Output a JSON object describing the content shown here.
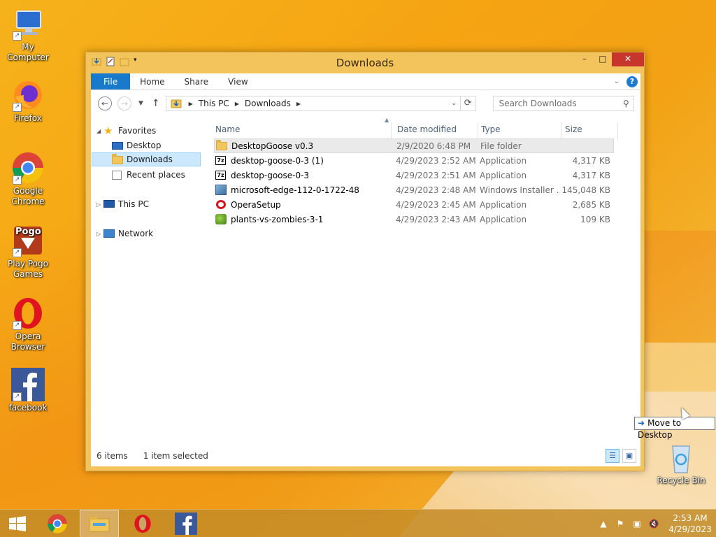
{
  "desktop": {
    "icons": [
      {
        "label": "My Computer"
      },
      {
        "label": "Firefox"
      },
      {
        "label": "Google Chrome"
      },
      {
        "label": "Play Pogo Games"
      },
      {
        "label": "Opera Browser"
      },
      {
        "label": "facebook"
      },
      {
        "label": "Recycle Bin"
      }
    ],
    "pogo_text": "Pogo"
  },
  "window": {
    "title": "Downloads",
    "controls": {
      "minimize": "–",
      "maximize": "□",
      "close": "✕"
    }
  },
  "ribbon": {
    "tabs": [
      {
        "label": "File"
      },
      {
        "label": "Home"
      },
      {
        "label": "Share"
      },
      {
        "label": "View"
      }
    ],
    "help": "?"
  },
  "nav": {
    "breadcrumb": [
      "This PC",
      "Downloads"
    ],
    "search_placeholder": "Search Downloads"
  },
  "navpane": {
    "items": [
      {
        "label": "Favorites"
      },
      {
        "label": "Desktop"
      },
      {
        "label": "Downloads"
      },
      {
        "label": "Recent places"
      },
      {
        "label": "This PC"
      },
      {
        "label": "Network"
      }
    ]
  },
  "filelist": {
    "columns": [
      "Name",
      "Date modified",
      "Type",
      "Size"
    ],
    "rows": [
      {
        "name": "DesktopGoose v0.3",
        "date": "2/9/2020 6:48 PM",
        "type": "File folder",
        "size": "",
        "icon": "folder-icon"
      },
      {
        "name": "desktop-goose-0-3 (1)",
        "date": "4/29/2023 2:52 AM",
        "type": "Application",
        "size": "4,317 KB",
        "icon": "7z-icon"
      },
      {
        "name": "desktop-goose-0-3",
        "date": "4/29/2023 2:51 AM",
        "type": "Application",
        "size": "4,317 KB",
        "icon": "7z-icon"
      },
      {
        "name": "microsoft-edge-112-0-1722-48",
        "date": "4/29/2023 2:48 AM",
        "type": "Windows Installer ...",
        "size": "145,048 KB",
        "icon": "installer-icon"
      },
      {
        "name": "OperaSetup",
        "date": "4/29/2023 2:45 AM",
        "type": "Application",
        "size": "2,685 KB",
        "icon": "opera-icon"
      },
      {
        "name": "plants-vs-zombies-3-1",
        "date": "4/29/2023 2:43 AM",
        "type": "Application",
        "size": "109 KB",
        "icon": "pvz-icon"
      }
    ]
  },
  "status": {
    "count": "6 items",
    "selection": "1 item selected"
  },
  "tooltip": {
    "text": "Move to Desktop"
  },
  "taskbar": {
    "time": "2:53 AM",
    "date": "4/29/2023"
  },
  "colors": {
    "accent": "#1979ca",
    "window_frame": "#f3c45b",
    "close_button": "#c7352c"
  }
}
